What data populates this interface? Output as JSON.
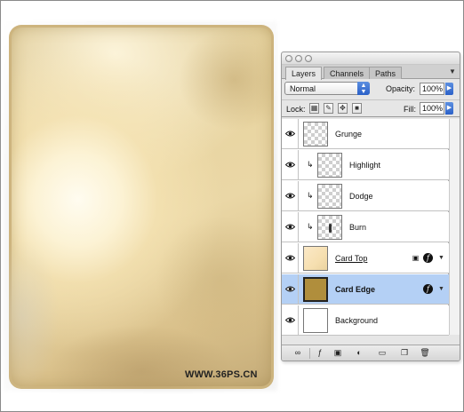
{
  "canvas": {
    "watermark": "WWW.36PS.CN"
  },
  "layers_panel": {
    "tabs": [
      {
        "label": "Layers",
        "active": true
      },
      {
        "label": "Channels",
        "active": false
      },
      {
        "label": "Paths",
        "active": false
      }
    ],
    "blend_mode": "Normal",
    "opacity_label": "Opacity:",
    "opacity_value": "100%",
    "lock_label": "Lock:",
    "fill_label": "Fill:",
    "fill_value": "100%",
    "layers": [
      {
        "name": "Grunge",
        "clipped": false,
        "selected": false,
        "thumb": "transparent"
      },
      {
        "name": "Highlight",
        "clipped": true,
        "selected": false,
        "thumb": "transparent"
      },
      {
        "name": "Dodge",
        "clipped": true,
        "selected": false,
        "thumb": "transparent"
      },
      {
        "name": "Burn",
        "clipped": true,
        "selected": false,
        "thumb": "burn"
      },
      {
        "name": "Card Top",
        "clipped": false,
        "selected": false,
        "thumb": "cardtop",
        "locked": true,
        "has_effects": true
      },
      {
        "name": "Card Edge",
        "clipped": false,
        "selected": true,
        "thumb": "cardedge",
        "has_effects": true
      },
      {
        "name": "Background",
        "clipped": false,
        "selected": false,
        "thumb": "white"
      }
    ],
    "icons": {
      "eye": "eye-icon",
      "clip": "clipping-arrow-icon",
      "lock": "lock-icon",
      "fx": "layer-effects-icon"
    },
    "accent_color": "#b4d0f5"
  }
}
